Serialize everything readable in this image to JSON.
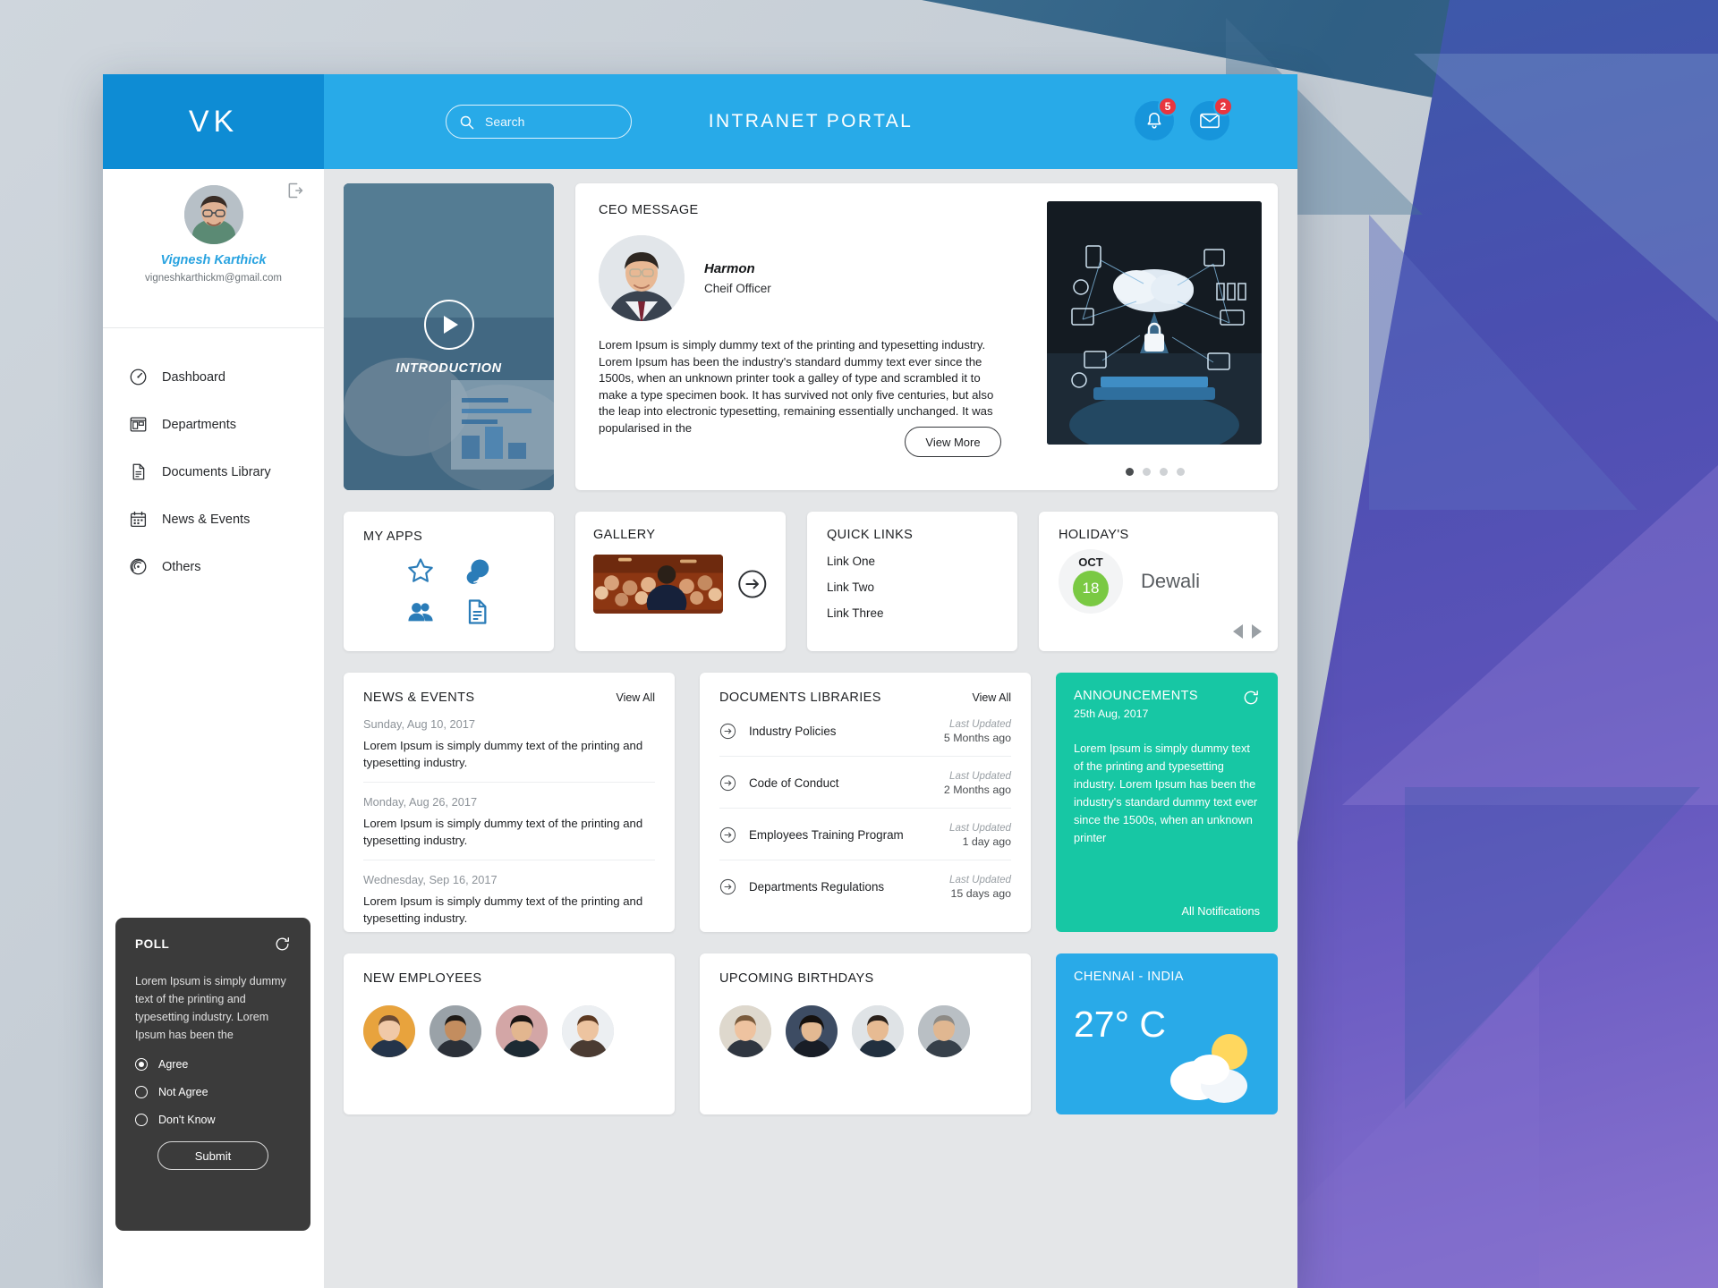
{
  "header": {
    "brand": "VK",
    "portal_title": "INTRANET PORTAL",
    "search_placeholder": "Search",
    "search_value": "",
    "notifications_count": "5",
    "messages_count": "2"
  },
  "sidebar": {
    "profile": {
      "name": "Vignesh Karthick",
      "email": "vigneshkarthickm@gmail.com"
    },
    "nav": [
      {
        "label": "Dashboard",
        "icon": "gauge-icon"
      },
      {
        "label": "Departments",
        "icon": "layout-icon"
      },
      {
        "label": "Documents Library",
        "icon": "document-icon"
      },
      {
        "label": "News & Events",
        "icon": "calendar-icon"
      },
      {
        "label": "Others",
        "icon": "signal-icon"
      }
    ],
    "poll": {
      "title": "POLL",
      "body": "Lorem Ipsum is simply dummy text of the printing and typesetting industry. Lorem Ipsum has been the",
      "options": [
        {
          "label": "Agree",
          "selected": true
        },
        {
          "label": "Not Agree",
          "selected": false
        },
        {
          "label": "Don't Know",
          "selected": false
        }
      ],
      "submit_label": "Submit"
    }
  },
  "promo": {
    "caption": "INTRODUCTION"
  },
  "ceo": {
    "title": "CEO MESSAGE",
    "name": "Harmon",
    "role": "Cheif Officer",
    "message": "Lorem Ipsum is simply dummy text of the printing and typesetting industry. Lorem Ipsum has been the industry's standard dummy text ever since the 1500s, when an unknown printer took a galley of type and scrambled it to make a type specimen book. It has survived not only five centuries, but also the leap into electronic typesetting, remaining essentially unchanged. It was popularised in the",
    "view_more_label": "View More",
    "carousel_dots": 4,
    "carousel_active": 0
  },
  "my_apps": {
    "title": "MY APPS",
    "icons": [
      "star-icon",
      "chat-icon",
      "users-icon",
      "document-icon"
    ]
  },
  "gallery": {
    "title": "GALLERY"
  },
  "quick_links": {
    "title": "QUICK LINKS",
    "links": [
      "Link One",
      "Link Two",
      "Link Three"
    ]
  },
  "holidays": {
    "title": "HOLIDAY'S",
    "month": "OCT",
    "day": "18",
    "name": "Dewali"
  },
  "news": {
    "title": "NEWS & EVENTS",
    "view_all": "View All",
    "items": [
      {
        "date": "Sunday, Aug 10, 2017",
        "text": "Lorem Ipsum is simply dummy text of the printing and typesetting industry."
      },
      {
        "date": "Monday, Aug 26, 2017",
        "text": "Lorem Ipsum is simply dummy text of the printing and typesetting industry."
      },
      {
        "date": "Wednesday, Sep 16, 2017",
        "text": "Lorem Ipsum is simply dummy text of the printing and typesetting industry."
      }
    ]
  },
  "documents": {
    "title": "DOCUMENTS LIBRARIES",
    "view_all": "View All",
    "items": [
      {
        "name": "Industry Policies",
        "updated_label": "Last Updated",
        "ago": "5 Months ago"
      },
      {
        "name": "Code of Conduct",
        "updated_label": "Last Updated",
        "ago": "2 Months ago"
      },
      {
        "name": "Employees Training Program",
        "updated_label": "Last Updated",
        "ago": "1 day ago"
      },
      {
        "name": "Departments Regulations",
        "updated_label": "Last Updated",
        "ago": "15 days ago"
      }
    ]
  },
  "announcements": {
    "title": "ANNOUNCEMENTS",
    "date": "25th Aug, 2017",
    "body": "Lorem Ipsum is simply dummy text of the printing and typesetting industry. Lorem Ipsum has been the industry's standard dummy text ever since the 1500s, when an unknown printer",
    "all_label": "All Notifications"
  },
  "new_employees": {
    "title": "NEW EMPLOYEES",
    "count": 4
  },
  "birthdays": {
    "title": "UPCOMING BIRTHDAYS",
    "count": 4
  },
  "weather": {
    "city": "CHENNAI - INDIA",
    "temp": "27° C"
  },
  "colors": {
    "brand_dark": "#0e8cd4",
    "brand": "#28aae8",
    "accent_green": "#17c7a4",
    "holiday_green": "#7ac943",
    "badge_red": "#e8363f",
    "poll_bg": "#3b3b3b"
  }
}
